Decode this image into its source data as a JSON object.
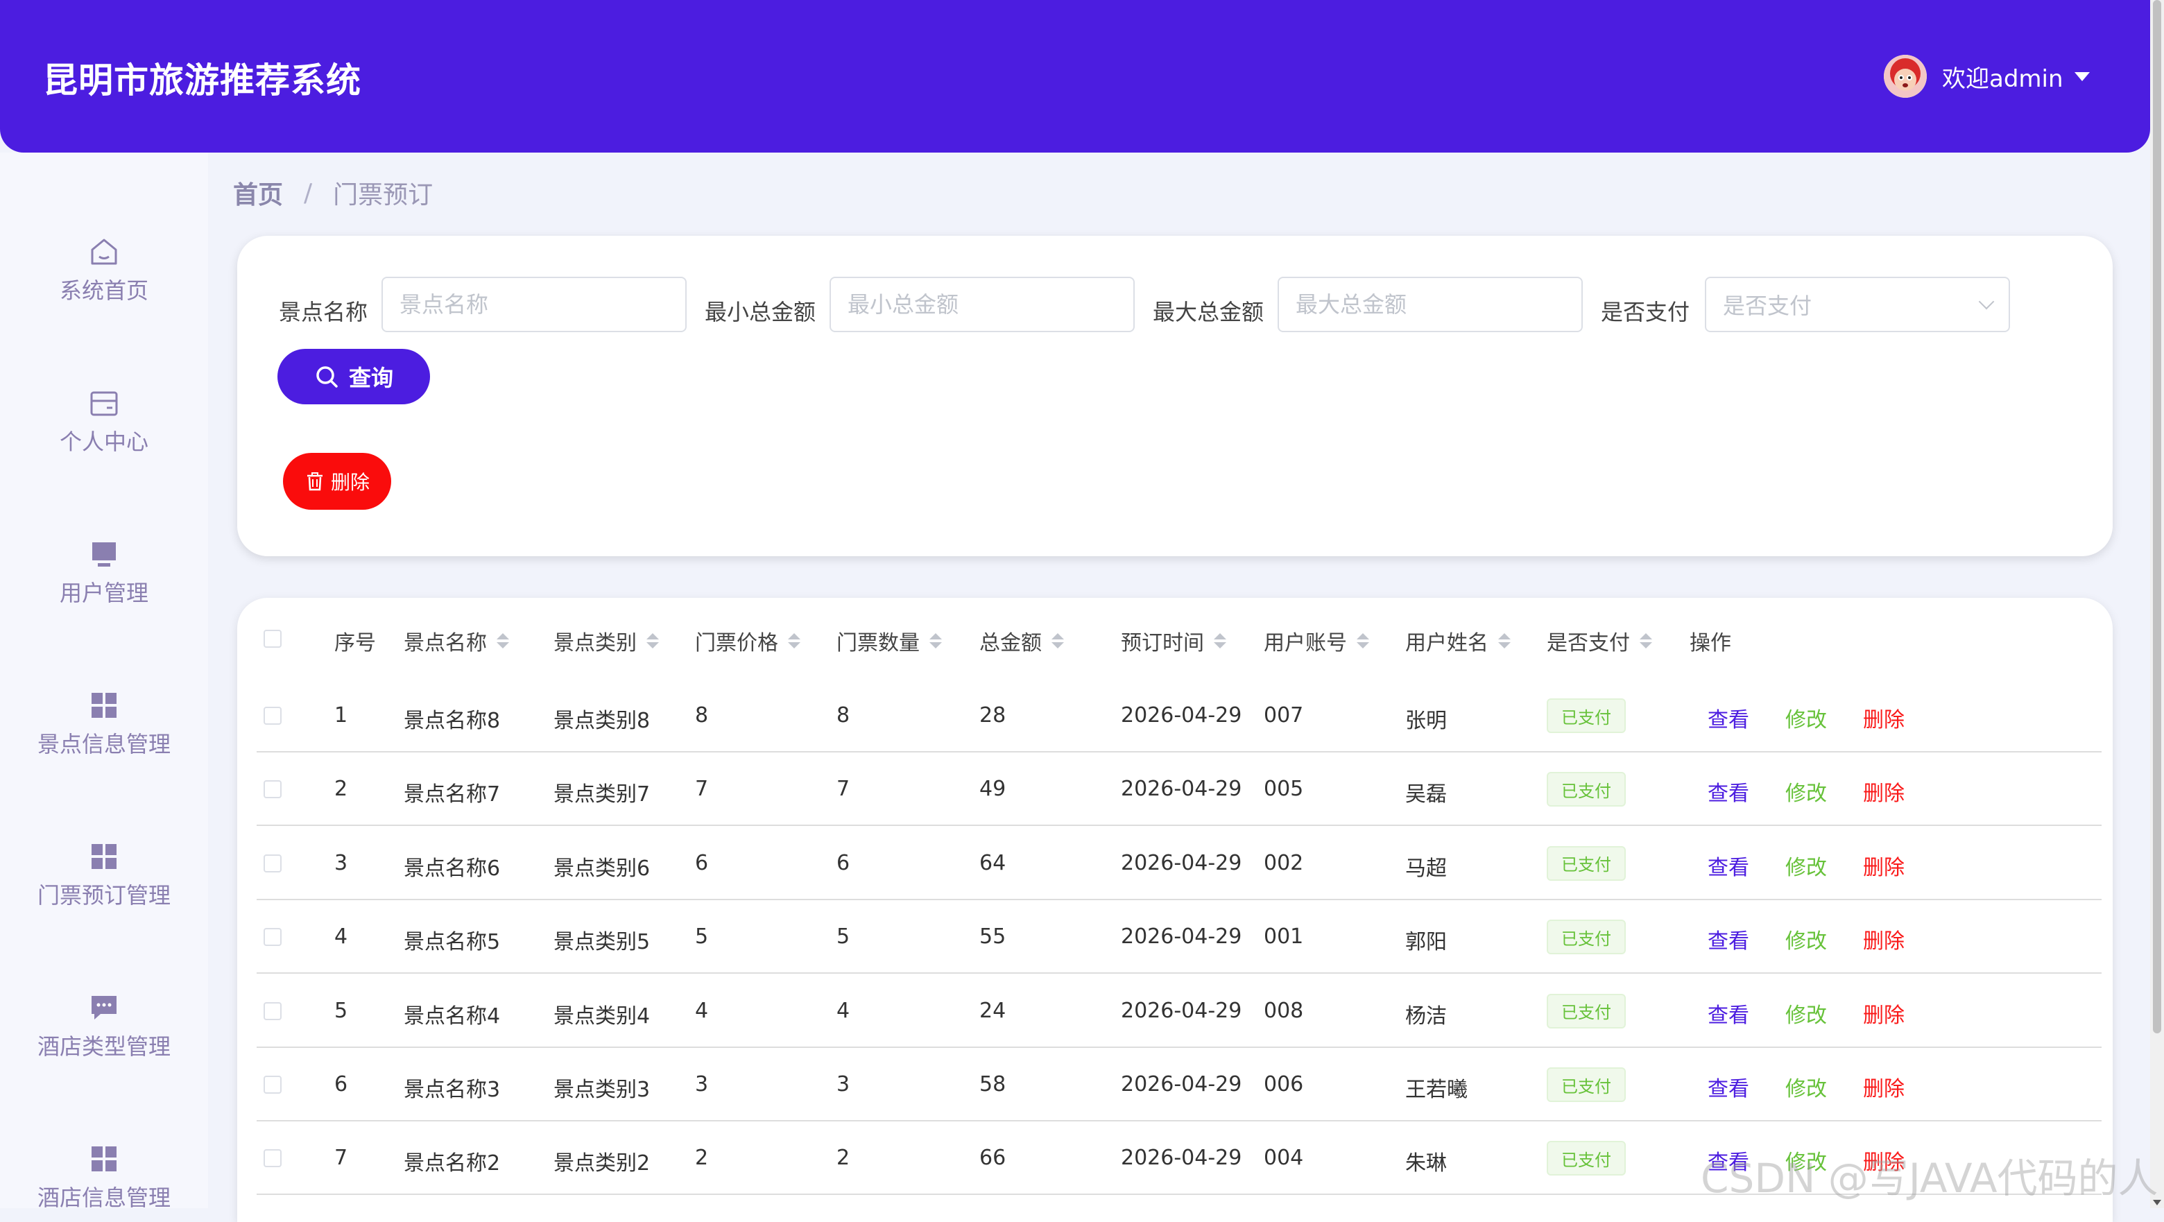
{
  "header": {
    "title": "昆明市旅游推荐系统",
    "welcome": "欢迎admin"
  },
  "sidebar": {
    "items": [
      {
        "label": "系统首页",
        "icon": "home-icon"
      },
      {
        "label": "个人中心",
        "icon": "wallet-icon"
      },
      {
        "label": "用户管理",
        "icon": "monitor-icon"
      },
      {
        "label": "景点信息管理",
        "icon": "grid-icon"
      },
      {
        "label": "门票预订管理",
        "icon": "grid-icon"
      },
      {
        "label": "酒店类型管理",
        "icon": "chat-icon"
      },
      {
        "label": "酒店信息管理",
        "icon": "grid-icon"
      }
    ]
  },
  "breadcrumb": {
    "home": "首页",
    "sep": "/",
    "current": "门票预订"
  },
  "search": {
    "name_label": "景点名称",
    "name_placeholder": "景点名称",
    "min_label": "最小总金额",
    "min_placeholder": "最小总金额",
    "max_label": "最大总金额",
    "max_placeholder": "最大总金额",
    "paid_label": "是否支付",
    "paid_placeholder": "是否支付",
    "query_label": "查询",
    "delete_label": "删除"
  },
  "table": {
    "headers": [
      "序号",
      "景点名称",
      "景点类别",
      "门票价格",
      "门票数量",
      "总金额",
      "预订时间",
      "用户账号",
      "用户姓名",
      "是否支付",
      "操作"
    ],
    "rows": [
      [
        "1",
        "景点名称8",
        "景点类别8",
        "8",
        "8",
        "28",
        "2026-04-29",
        "007",
        "张明",
        "已支付"
      ],
      [
        "2",
        "景点名称7",
        "景点类别7",
        "7",
        "7",
        "49",
        "2026-04-29",
        "005",
        "吴磊",
        "已支付"
      ],
      [
        "3",
        "景点名称6",
        "景点类别6",
        "6",
        "6",
        "64",
        "2026-04-29",
        "002",
        "马超",
        "已支付"
      ],
      [
        "4",
        "景点名称5",
        "景点类别5",
        "5",
        "5",
        "55",
        "2026-04-29",
        "001",
        "郭阳",
        "已支付"
      ],
      [
        "5",
        "景点名称4",
        "景点类别4",
        "4",
        "4",
        "24",
        "2026-04-29",
        "008",
        "杨洁",
        "已支付"
      ],
      [
        "6",
        "景点名称3",
        "景点类别3",
        "3",
        "3",
        "58",
        "2026-04-29",
        "006",
        "王若曦",
        "已支付"
      ],
      [
        "7",
        "景点名称2",
        "景点类别2",
        "2",
        "2",
        "66",
        "2026-04-29",
        "004",
        "朱琳",
        "已支付"
      ]
    ],
    "actions": {
      "view": "查看",
      "edit": "修改",
      "delete": "删除"
    }
  },
  "watermark": "CSDN @写JAVA代码的人",
  "colors": {
    "primary": "#4c1de0",
    "danger": "#fa0c0c",
    "success": "#67c23a"
  }
}
